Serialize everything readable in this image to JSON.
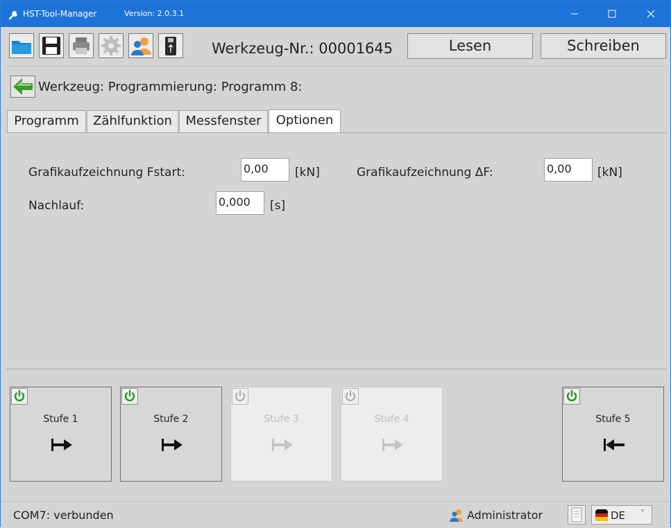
{
  "window": {
    "title": "HST-Tool-Manager",
    "version": "Version: 2.0.3.1",
    "title_bar_color": "#1e73d8"
  },
  "toolbar": {
    "icons": [
      "folder-icon",
      "save-icon",
      "print-icon",
      "settings-icon",
      "user-icon",
      "usb-icon"
    ],
    "tool_number": "Werkzeug-Nr.: 00001645",
    "read_label": "Lesen",
    "write_label": "Schreiben"
  },
  "breadcrumb": {
    "text": "Werkzeug: Programmierung: Programm 8:"
  },
  "tabs": [
    {
      "label": "Programm",
      "active": false
    },
    {
      "label": "Zählfunktion",
      "active": false
    },
    {
      "label": "Messfenster",
      "active": false
    },
    {
      "label": "Optionen",
      "active": true
    }
  ],
  "options": {
    "fstart_label": "Grafikaufzeichnung Fstart:",
    "fstart_value": "0,00",
    "fstart_unit": "[kN]",
    "delta_f_label": "Grafikaufzeichnung ΔF:",
    "delta_f_value": "0,00",
    "delta_f_unit": "[kN]",
    "nachlauf_label": "Nachlauf:",
    "nachlauf_value": "0,000",
    "nachlauf_unit": "[s]"
  },
  "stages": [
    {
      "label": "Stufe 1",
      "enabled": true,
      "direction": "right"
    },
    {
      "label": "Stufe 2",
      "enabled": true,
      "direction": "right"
    },
    {
      "label": "Stufe 3",
      "enabled": false,
      "direction": "right"
    },
    {
      "label": "Stufe 4",
      "enabled": false,
      "direction": "right"
    },
    {
      "label": "Stufe 5",
      "enabled": true,
      "direction": "left"
    }
  ],
  "status": {
    "connection": "COM7: verbunden",
    "user": "Administrator",
    "language": "DE"
  },
  "colors": {
    "power_enabled": "#1a9e1a",
    "power_disabled": "#a8a8a8",
    "back_arrow": "#3c9a2d"
  }
}
